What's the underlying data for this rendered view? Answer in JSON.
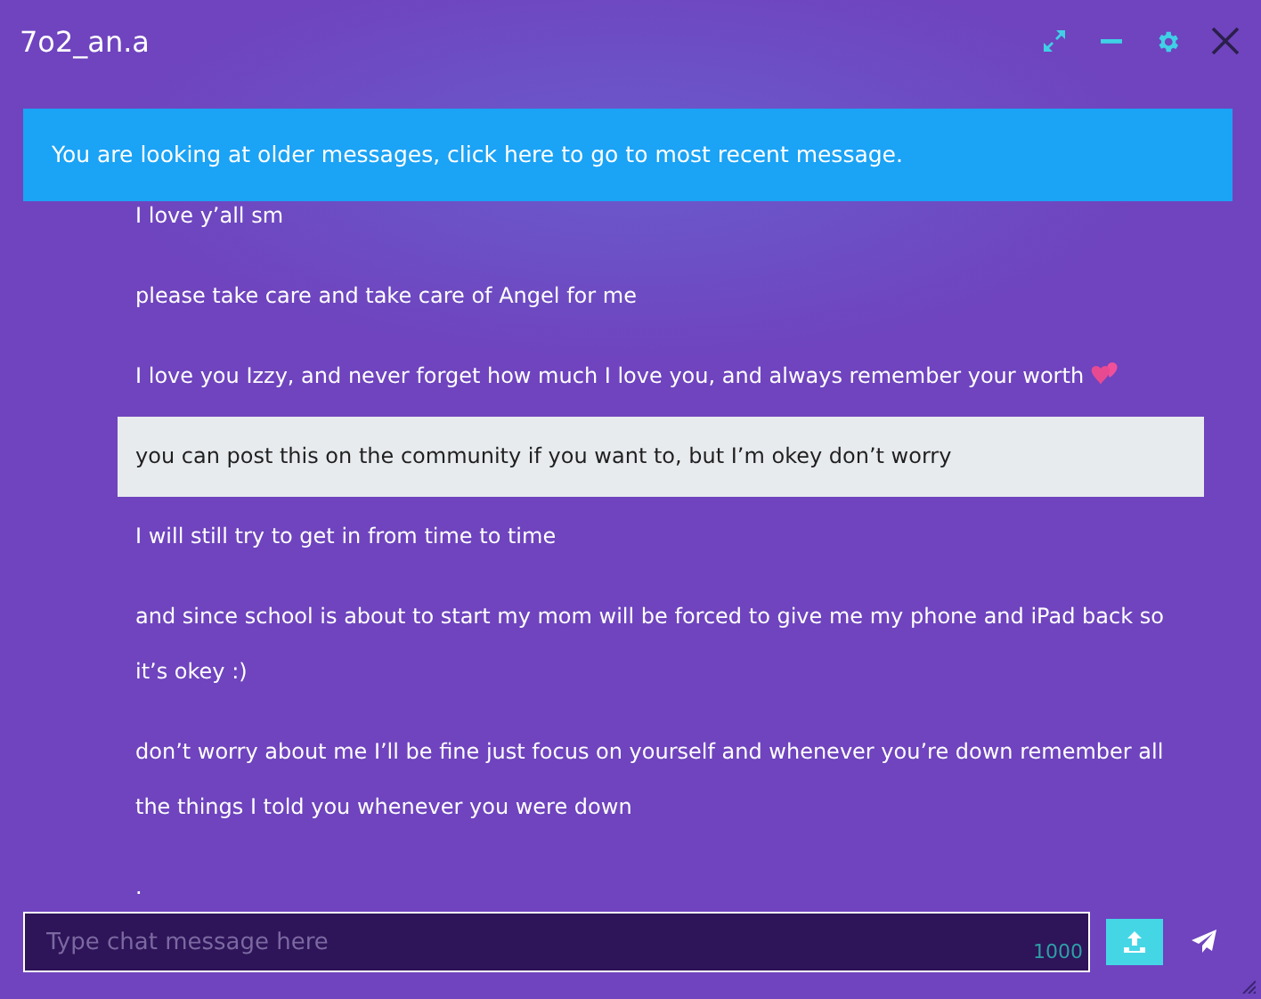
{
  "window": {
    "title": "7o2_an.a"
  },
  "banner": {
    "text": "You are looking at older messages, click here to go to most recent message."
  },
  "messages": [
    {
      "text": "I love y’all sm",
      "highlighted": false,
      "emoji": false
    },
    {
      "text": "please take care and take care of Angel for me",
      "highlighted": false,
      "emoji": false
    },
    {
      "text": "I love you Izzy, and never forget how much I love you, and always remember your worth",
      "highlighted": false,
      "emoji": true
    },
    {
      "text": "you can post this on the community if you want to, but I’m okey don’t worry",
      "highlighted": true,
      "emoji": false
    },
    {
      "text": "I will still try to get in from time to time",
      "highlighted": false,
      "emoji": false
    },
    {
      "text": "and since school is about to start my mom will be forced to give me my phone and iPad back so it’s okey :)",
      "highlighted": false,
      "emoji": false
    },
    {
      "text": "don’t worry about me I’ll be fine just focus on yourself and whenever you’re down remember all the things I told you whenever you were down",
      "highlighted": false,
      "emoji": false
    },
    {
      "text": ".",
      "highlighted": false,
      "emoji": false
    }
  ],
  "composer": {
    "placeholder": "Type chat message here",
    "counter": "1000"
  }
}
